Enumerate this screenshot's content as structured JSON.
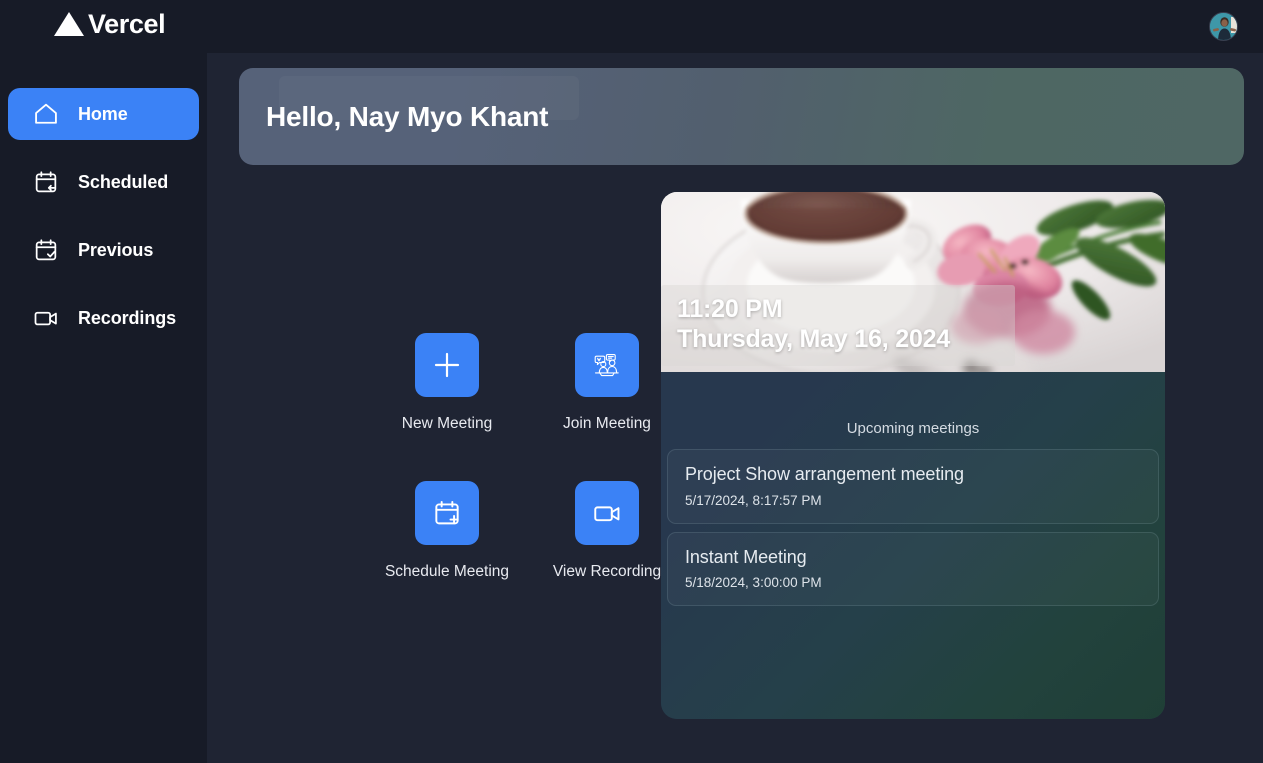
{
  "app": {
    "brand_name": "Vercel",
    "brand_icon": "vercel-triangle-logo",
    "avatar_icon": "user-avatar-photo"
  },
  "sidebar": {
    "items": [
      {
        "label": "Home",
        "icon": "home-icon",
        "active": true
      },
      {
        "label": "Scheduled",
        "icon": "calendar-arrow-icon",
        "active": false
      },
      {
        "label": "Previous",
        "icon": "calendar-check-icon",
        "active": false
      },
      {
        "label": "Recordings",
        "icon": "video-camera-icon",
        "active": false
      }
    ]
  },
  "greeting": {
    "text": "Hello, Nay Myo Khant"
  },
  "actions": [
    {
      "label": "New Meeting",
      "icon": "plus-icon"
    },
    {
      "label": "Join Meeting",
      "icon": "people-meeting-icon"
    },
    {
      "label": "Schedule Meeting",
      "icon": "calendar-plus-icon"
    },
    {
      "label": "View Recording",
      "icon": "video-camera-icon"
    }
  ],
  "info_card": {
    "photo_alt": "teacup-with-pink-flowers-photo",
    "time": "11:20 PM",
    "date": "Thursday, May 16, 2024",
    "upcoming_title": "Upcoming meetings",
    "meetings": [
      {
        "name": "Project Show arrangement meeting",
        "time": "5/17/2024, 8:17:57 PM"
      },
      {
        "name": "Instant Meeting",
        "time": "5/18/2024, 3:00:00 PM"
      }
    ]
  },
  "colors": {
    "accent_blue": "#3b82f6",
    "sidebar_bg": "#171b27",
    "main_bg": "#1f2433",
    "banner_left": "#566279",
    "banner_right": "#4f6764"
  }
}
